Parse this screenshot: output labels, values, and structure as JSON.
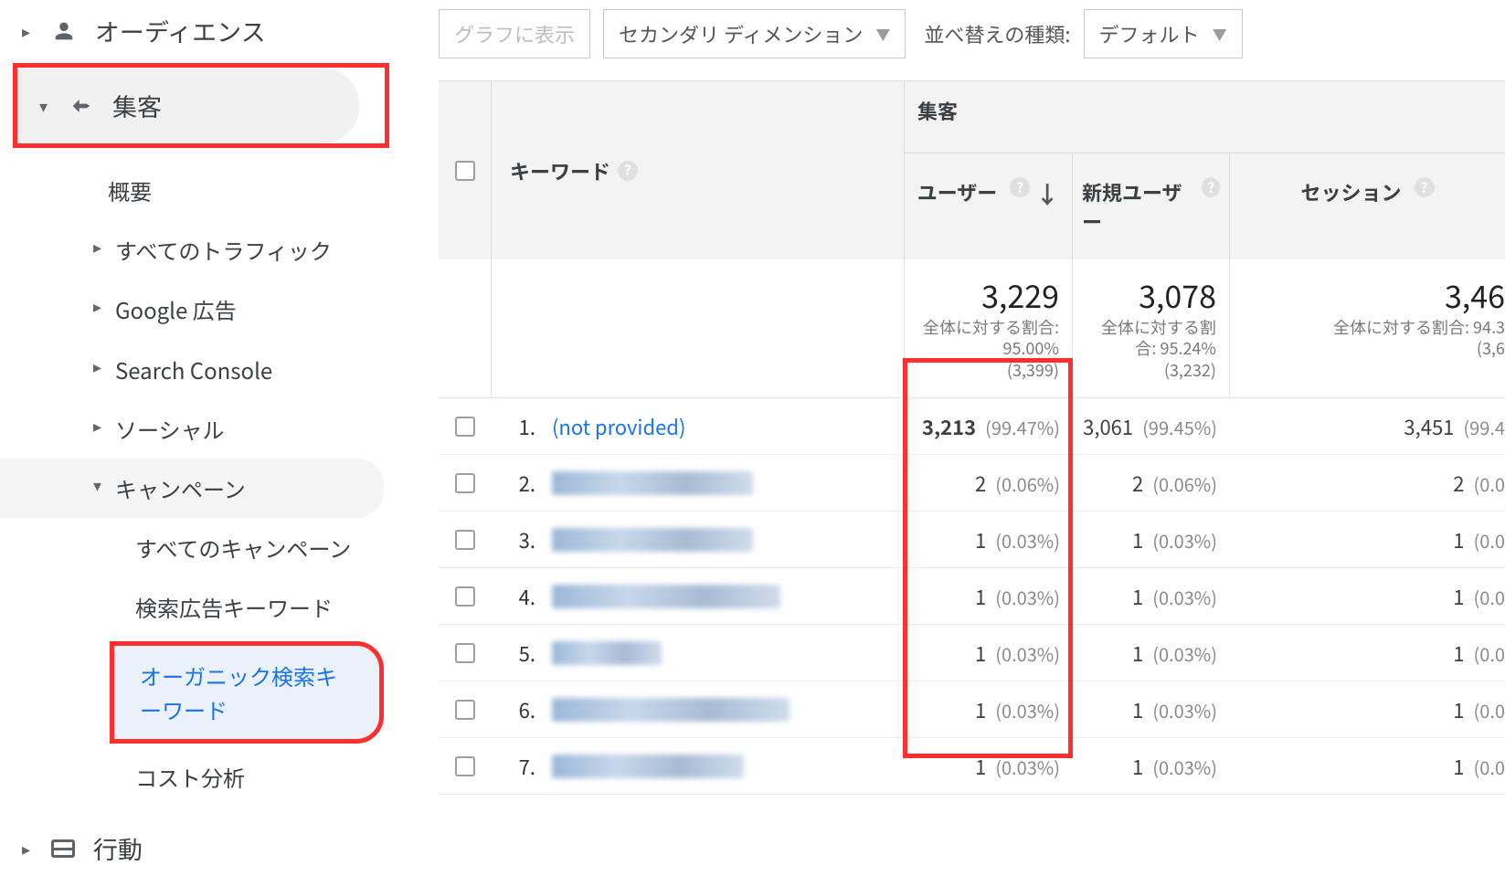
{
  "sidebar": {
    "audience_label": "オーディエンス",
    "acquisition_label": "集客",
    "overview": "概要",
    "all_traffic": "すべてのトラフィック",
    "google_ads": "Google 広告",
    "search_console": "Search Console",
    "social": "ソーシャル",
    "campaign": "キャンペーン",
    "campaign_children": {
      "all_campaigns": "すべてのキャンペーン",
      "paid_keywords": "検索広告キーワード",
      "organic_keywords": "オーガニック検索キーワード",
      "cost_analysis": "コスト分析"
    },
    "behavior_label": "行動"
  },
  "toolbar": {
    "plot_rows": "グラフに表示",
    "secondary_dimension": "セカンダリ ディメンション",
    "sort_type_label": "並べ替えの種類:",
    "sort_default": "デフォルト"
  },
  "table": {
    "keyword_header": "キーワード",
    "group_header": "集客",
    "metrics": {
      "users": "ユーザー",
      "new_users": "新規ユーザー",
      "sessions": "セッション"
    },
    "summary": {
      "users": {
        "value": "3,229",
        "sub1": "全体に対する割合: 95.00%",
        "sub2": "(3,399)"
      },
      "new": {
        "value": "3,078",
        "sub1": "全体に対する割合: 95.24%",
        "sub2": "(3,232)"
      },
      "session": {
        "value": "3,46",
        "sub1": "全体に対する割合: 94.3",
        "sub2": "(3,6"
      }
    },
    "rows": [
      {
        "n": "1.",
        "keyword": "(not provided)",
        "blurred": false,
        "blur_w": 0,
        "users": {
          "v": "3,213",
          "p": "(99.47%)",
          "bold": true
        },
        "new": {
          "v": "3,061",
          "p": "(99.45%)"
        },
        "sess": {
          "v": "3,451",
          "p": "(99.4"
        }
      },
      {
        "n": "2.",
        "keyword": "",
        "blurred": true,
        "blur_w": 220,
        "users": {
          "v": "2",
          "p": "(0.06%)"
        },
        "new": {
          "v": "2",
          "p": "(0.06%)"
        },
        "sess": {
          "v": "2",
          "p": "(0.0"
        }
      },
      {
        "n": "3.",
        "keyword": "",
        "blurred": true,
        "blur_w": 220,
        "users": {
          "v": "1",
          "p": "(0.03%)"
        },
        "new": {
          "v": "1",
          "p": "(0.03%)"
        },
        "sess": {
          "v": "1",
          "p": "(0.0"
        }
      },
      {
        "n": "4.",
        "keyword": "",
        "blurred": true,
        "blur_w": 250,
        "users": {
          "v": "1",
          "p": "(0.03%)"
        },
        "new": {
          "v": "1",
          "p": "(0.03%)"
        },
        "sess": {
          "v": "1",
          "p": "(0.0"
        }
      },
      {
        "n": "5.",
        "keyword": "",
        "blurred": true,
        "blur_w": 120,
        "users": {
          "v": "1",
          "p": "(0.03%)"
        },
        "new": {
          "v": "1",
          "p": "(0.03%)"
        },
        "sess": {
          "v": "1",
          "p": "(0.0"
        }
      },
      {
        "n": "6.",
        "keyword": "",
        "blurred": true,
        "blur_w": 260,
        "users": {
          "v": "1",
          "p": "(0.03%)"
        },
        "new": {
          "v": "1",
          "p": "(0.03%)"
        },
        "sess": {
          "v": "1",
          "p": "(0.0"
        }
      },
      {
        "n": "7.",
        "keyword": "",
        "blurred": true,
        "blur_w": 210,
        "users": {
          "v": "1",
          "p": "(0.03%)"
        },
        "new": {
          "v": "1",
          "p": "(0.03%)"
        },
        "sess": {
          "v": "1",
          "p": "(0.0"
        }
      }
    ]
  }
}
